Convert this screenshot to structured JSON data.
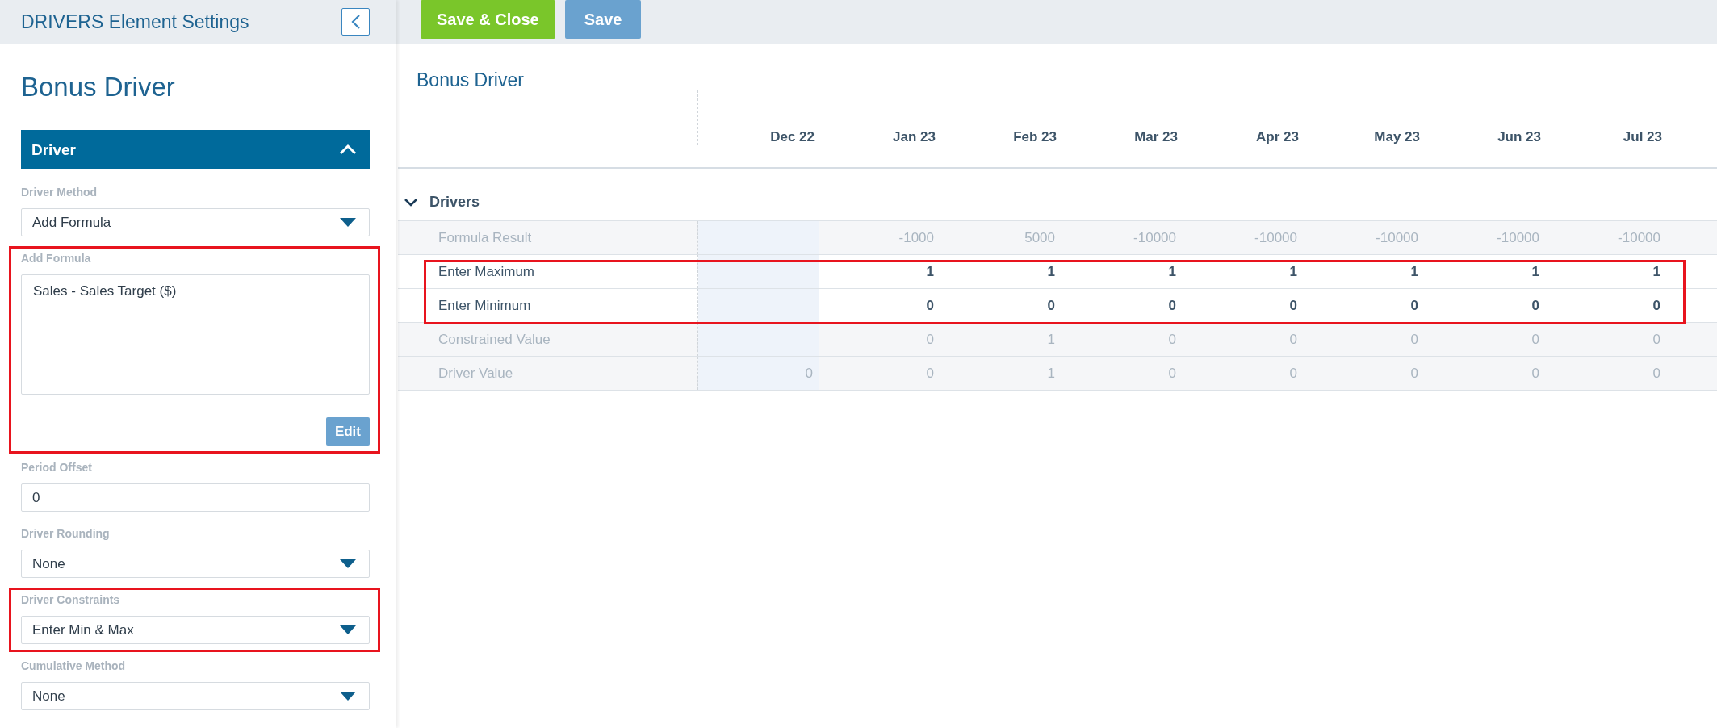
{
  "panel": {
    "title": "DRIVERS Element Settings",
    "heading": "Bonus Driver",
    "section": {
      "label": "Driver",
      "expanded": true
    },
    "fields": [
      {
        "kind": "select",
        "label": "Driver Method",
        "value": "Add Formula",
        "highlighted": false
      },
      {
        "kind": "formula",
        "label": "Add Formula",
        "value": "Sales - Sales Target ($)",
        "button": "Edit",
        "highlighted": true
      },
      {
        "kind": "input",
        "label": "Period Offset",
        "value": "0",
        "highlighted": false
      },
      {
        "kind": "select",
        "label": "Driver Rounding",
        "value": "None",
        "highlighted": false
      },
      {
        "kind": "select",
        "label": "Driver Constraints",
        "value": "Enter Min & Max",
        "highlighted": true
      },
      {
        "kind": "select",
        "label": "Cumulative Method",
        "value": "None",
        "highlighted": false
      }
    ]
  },
  "toolbar": {
    "buttons": [
      {
        "label": "Save & Close",
        "kind": "primary"
      },
      {
        "label": "Save",
        "kind": "secondary"
      }
    ]
  },
  "grid": {
    "title": "Bonus Driver",
    "columns": [
      {
        "label": "Dec 22",
        "shaded": true
      },
      {
        "label": "Jan 23",
        "shaded": false
      },
      {
        "label": "Feb 23",
        "shaded": false
      },
      {
        "label": "Mar 23",
        "shaded": false
      },
      {
        "label": "Apr 23",
        "shaded": false
      },
      {
        "label": "May 23",
        "shaded": false
      },
      {
        "label": "Jun 23",
        "shaded": false
      },
      {
        "label": "Jul 23",
        "shaded": false
      }
    ],
    "group": {
      "label": "Drivers",
      "expanded": true
    },
    "rows": [
      {
        "label": "Formula Result",
        "kind": "computed",
        "highlighted": false,
        "values": [
          "-1000",
          "5000",
          "-10000",
          "-10000",
          "-10000",
          "-10000",
          "-10000"
        ]
      },
      {
        "label": "Enter Maximum",
        "kind": "input",
        "highlighted": true,
        "values": [
          "1",
          "1",
          "1",
          "1",
          "1",
          "1",
          "1"
        ]
      },
      {
        "label": "Enter Minimum",
        "kind": "input",
        "highlighted": true,
        "values": [
          "0",
          "0",
          "0",
          "0",
          "0",
          "0",
          "0"
        ]
      },
      {
        "label": "Constrained Value",
        "kind": "computed",
        "highlighted": false,
        "values": [
          "0",
          "1",
          "0",
          "0",
          "0",
          "0",
          "0"
        ]
      },
      {
        "label": "Driver Value",
        "kind": "computed",
        "highlighted": false,
        "values": [
          "0",
          "0",
          "1",
          "0",
          "0",
          "0",
          "0",
          "0"
        ]
      }
    ]
  }
}
